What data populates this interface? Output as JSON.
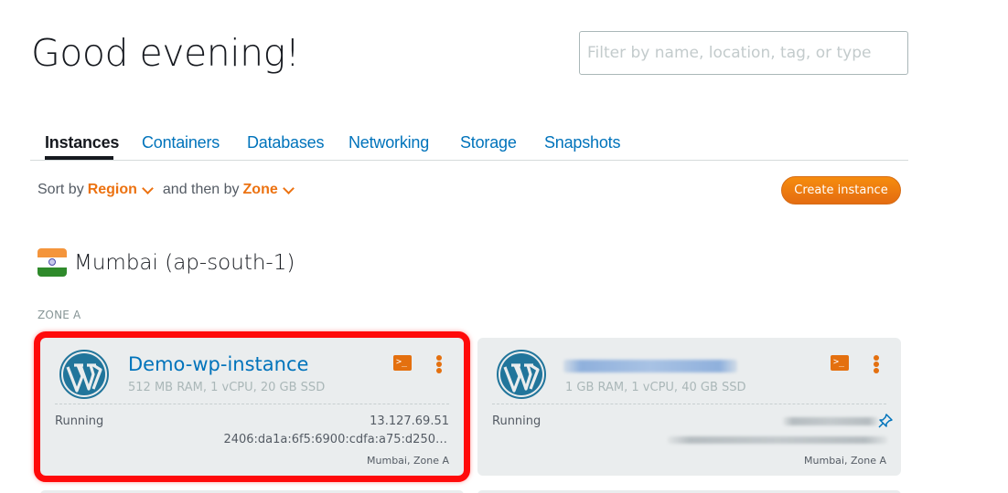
{
  "header": {
    "greeting": "Good evening!",
    "filter_placeholder": "Filter by name, location, tag, or type",
    "filter_value": ""
  },
  "tabs": [
    {
      "label": "Instances",
      "active": true
    },
    {
      "label": "Containers",
      "active": false
    },
    {
      "label": "Databases",
      "active": false
    },
    {
      "label": "Networking",
      "active": false
    },
    {
      "label": "Storage",
      "active": false
    },
    {
      "label": "Snapshots",
      "active": false
    }
  ],
  "sort": {
    "prefix": "Sort by",
    "primary": "Region",
    "middle": "and then by",
    "secondary": "Zone"
  },
  "create_button": "Create instance",
  "region": {
    "name": "Mumbai (ap-south-1)",
    "flag": "india-flag",
    "zone_label": "ZONE A"
  },
  "instances": [
    {
      "name": "Demo-wp-instance",
      "spec": "512 MB RAM, 1 vCPU, 20 GB SSD",
      "status": "Running",
      "ipv4": "13.127.69.51",
      "ipv6": "2406:da1a:6f5:6900:cdfa:a75:d250…",
      "location": "Mumbai, Zone A",
      "blueprint_icon": "wordpress-icon",
      "highlighted": true,
      "name_redacted": false
    },
    {
      "name": "",
      "spec": "1 GB RAM, 1 vCPU, 40 GB SSD",
      "status": "Running",
      "ipv4": "",
      "ipv6": "",
      "location": "Mumbai, Zone A",
      "blueprint_icon": "wordpress-icon",
      "highlighted": false,
      "name_redacted": true,
      "static_ip_pinned": true
    }
  ],
  "colors": {
    "accent_orange": "#ec7211",
    "link_blue": "#0073bb",
    "card_bg": "#eaedee",
    "highlight_red": "#ff0a0a",
    "wordpress_blue": "#21759b"
  }
}
